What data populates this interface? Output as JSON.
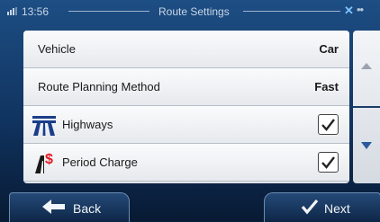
{
  "status_bar": {
    "time": "13:56",
    "title": "Route Settings"
  },
  "settings": {
    "rows": [
      {
        "label": "Vehicle",
        "value": "Car"
      },
      {
        "label": "Route Planning Method",
        "value": "Fast"
      },
      {
        "label": "Highways",
        "checked": true,
        "icon": "highway-icon"
      },
      {
        "label": "Period Charge",
        "checked": true,
        "icon": "toll-charge-icon"
      }
    ]
  },
  "buttons": {
    "back_label": "Back",
    "next_label": "Next"
  },
  "colors": {
    "accent_blue": "#1d4e84",
    "row_text": "#1a1a1a",
    "toll_dollar": "#e31b23"
  }
}
